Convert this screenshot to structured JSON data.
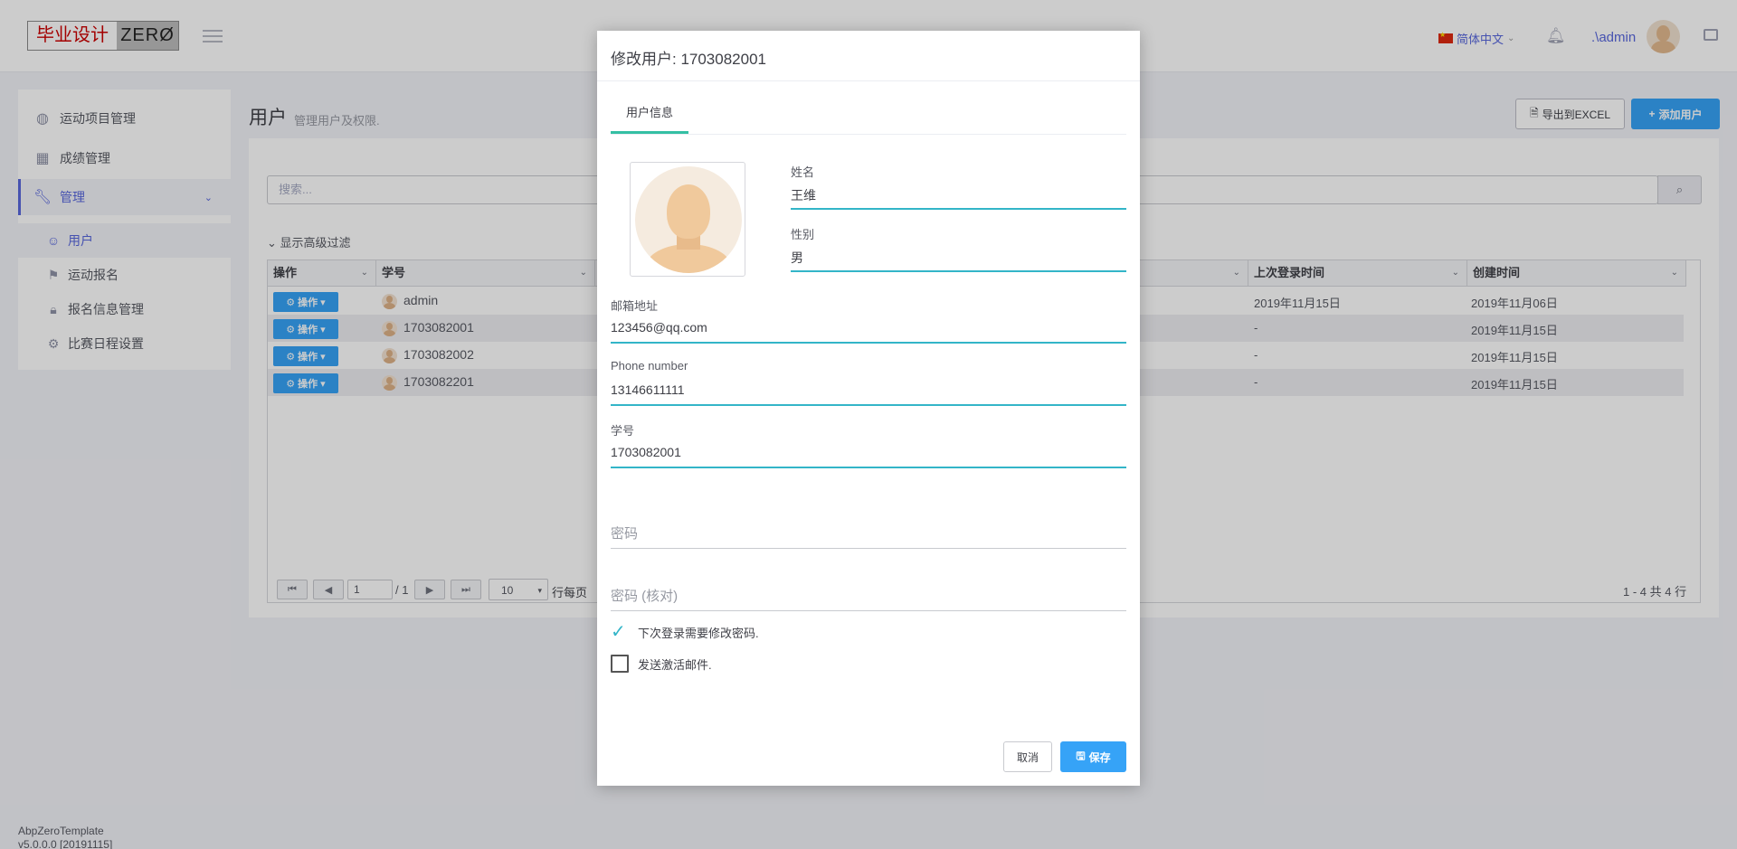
{
  "header": {
    "logo_cn": "毕业设计",
    "logo_en": "ZERØ",
    "language": "简体中文",
    "username": ".\\admin"
  },
  "sidebar": {
    "items": [
      {
        "label": "运动项目管理",
        "icon": "globe-icon"
      },
      {
        "label": "成绩管理",
        "icon": "grid-icon"
      },
      {
        "label": "管理",
        "icon": "wrench-icon"
      }
    ],
    "subitems": [
      {
        "label": "用户",
        "icon": "user-icon"
      },
      {
        "label": "运动报名",
        "icon": "flag-icon"
      },
      {
        "label": "报名信息管理",
        "icon": "lock-icon"
      },
      {
        "label": "比赛日程设置",
        "icon": "gear-icon"
      }
    ]
  },
  "page": {
    "title": "用户",
    "subtitle": "管理用户及权限.",
    "export_label": "导出到EXCEL",
    "add_label": "添加用户",
    "search_placeholder": "搜索...",
    "advanced_filter": "显示高级过滤"
  },
  "table": {
    "headers": [
      "操作",
      "学号",
      "上次登录时间",
      "创建时间"
    ],
    "action_label": "操作",
    "rows": [
      {
        "id": "admin",
        "last_login": "2019年11月15日",
        "created": "2019年11月06日"
      },
      {
        "id": "1703082001",
        "last_login": "-",
        "created": "2019年11月15日"
      },
      {
        "id": "1703082002",
        "last_login": "-",
        "created": "2019年11月15日"
      },
      {
        "id": "1703082201",
        "last_login": "-",
        "created": "2019年11月15日"
      }
    ]
  },
  "pager": {
    "page": "1",
    "total": "/ 1",
    "page_size": "10",
    "page_size_label": "行每页",
    "info": "1 - 4 共 4 行"
  },
  "footer": {
    "line1": "AbpZeroTemplate",
    "line2": "v5.0.0.0 [20191115]"
  },
  "modal": {
    "title": "修改用户: 1703082001",
    "tab": "用户信息",
    "fields": {
      "name_label": "姓名",
      "name_value": "王维",
      "gender_label": "性别",
      "gender_value": "男",
      "email_label": "邮箱地址",
      "email_value": "123456@qq.com",
      "phone_label": "Phone number",
      "phone_value": "13146611111",
      "student_id_label": "学号",
      "student_id_value": "1703082001",
      "password_placeholder": "密码",
      "password_confirm_placeholder": "密码 (核对)"
    },
    "checks": {
      "change_password": "下次登录需要修改密码.",
      "send_activation": "发送激活邮件."
    },
    "cancel_label": "取消",
    "save_label": "保存"
  },
  "colors": {
    "primary": "#36a3f7",
    "accent_line": "#33b5c8",
    "nav_active": "#5867dd"
  }
}
